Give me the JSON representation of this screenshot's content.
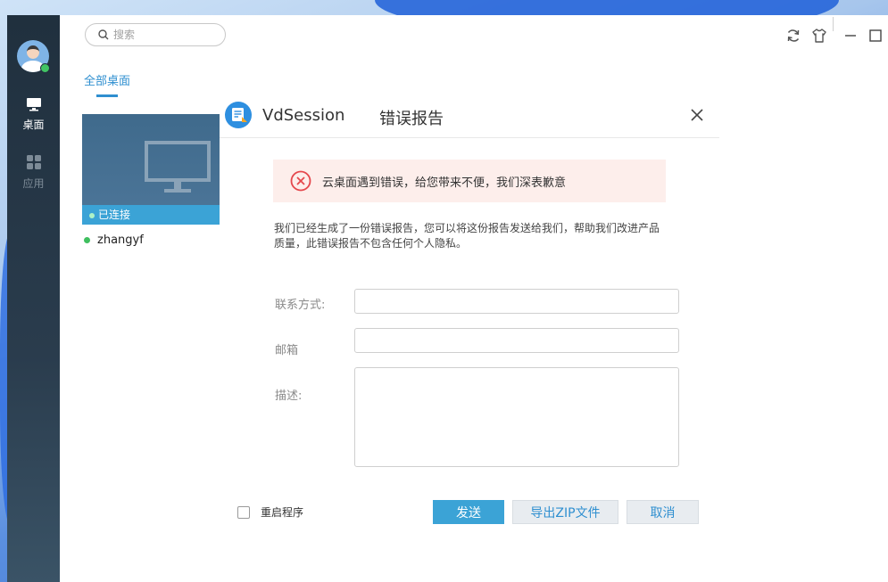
{
  "search": {
    "placeholder": "搜索"
  },
  "sidebar": {
    "items": [
      {
        "label": "桌面",
        "icon": "monitor-icon",
        "active": true
      },
      {
        "label": "应用",
        "icon": "apps-grid-icon",
        "active": false
      }
    ]
  },
  "main": {
    "tab_label": "全部桌面",
    "desktop": {
      "status": "已连接",
      "user": "zhangyf"
    }
  },
  "dialog": {
    "app_name": "VdSession",
    "title": "错误报告",
    "error_message": "云桌面遇到错误，给您带来不便，我们深表歉意",
    "description": "我们已经生成了一份错误报告，您可以将这份报告发送给我们，帮助我们改进产品质量，此错误报告不包含任何个人隐私。",
    "fields": {
      "contact_label": "联系方式:",
      "email_label": "邮箱",
      "desc_label": "描述:"
    },
    "restart_label": "重启程序",
    "buttons": {
      "send": "发送",
      "export": "导出ZIP文件",
      "cancel": "取消"
    }
  },
  "colors": {
    "accent": "#3ba3d6",
    "link": "#2f8fd0",
    "error": "#e5484d",
    "online": "#3fbf5f"
  }
}
